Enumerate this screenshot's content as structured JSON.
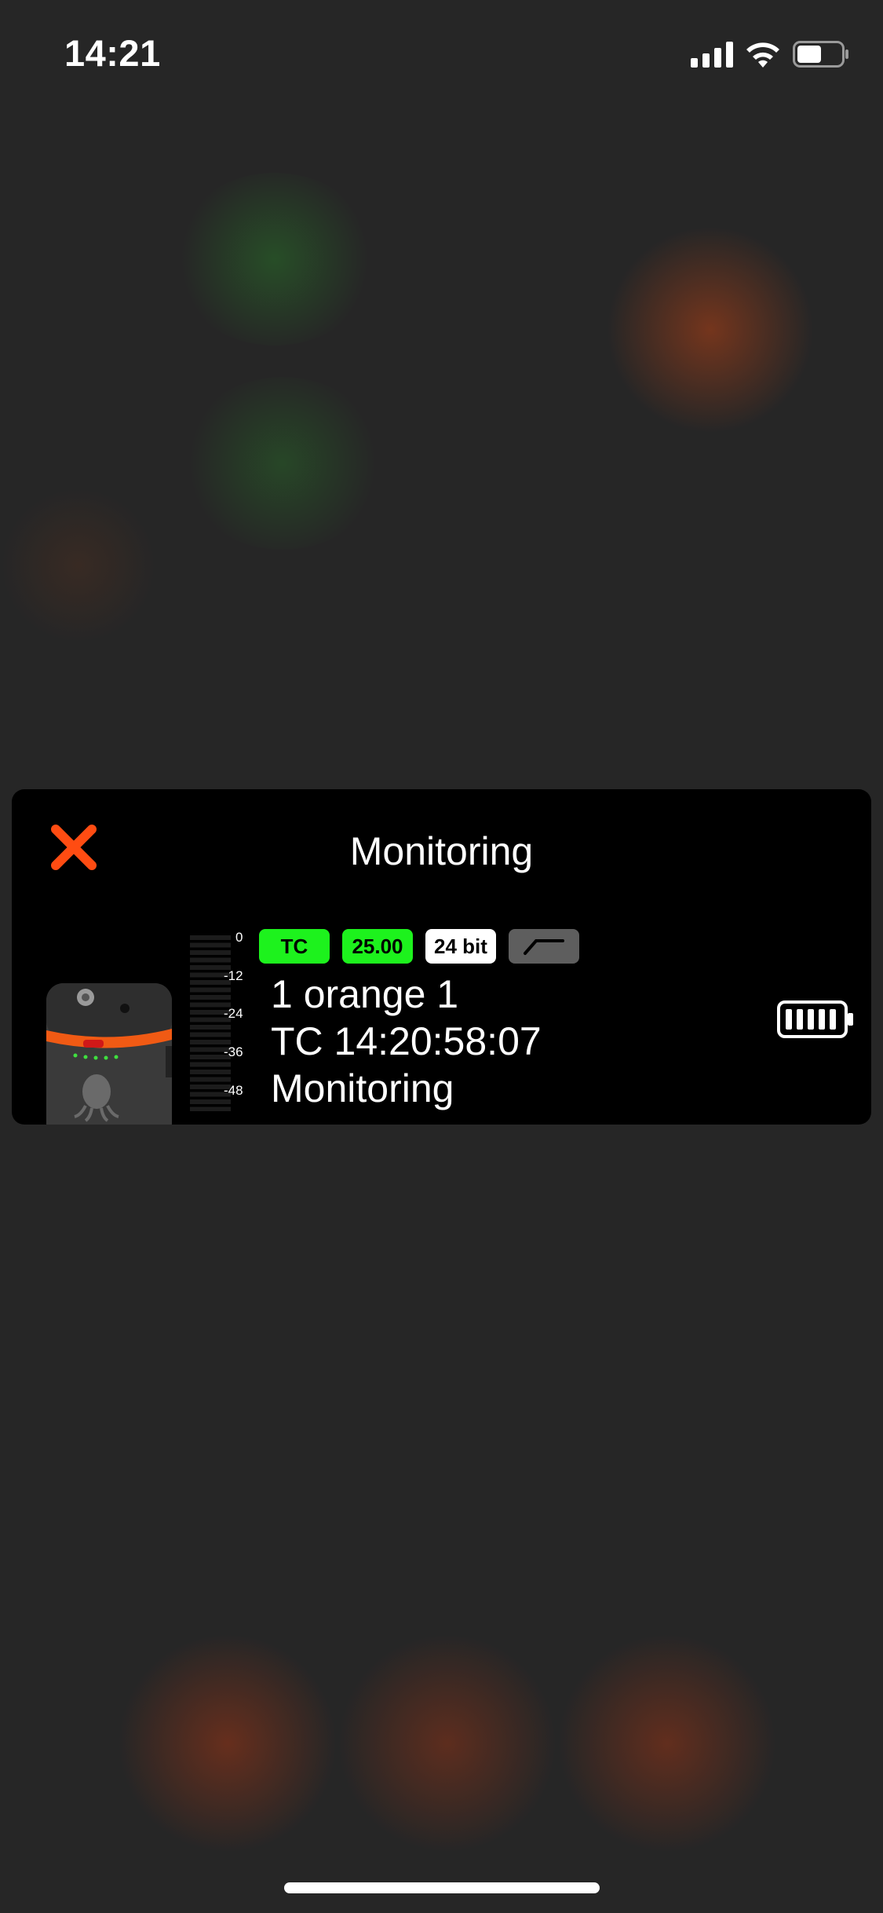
{
  "status_bar": {
    "time": "14:21",
    "icons": [
      "cellular-signal-icon",
      "wifi-icon",
      "battery-icon"
    ]
  },
  "monitoring_panel": {
    "title": "Monitoring",
    "close_icon": "close-x-icon",
    "device_image": "tentacle-track-recorder",
    "meter": {
      "scale_labels": [
        "0",
        "-12",
        "-24",
        "-36",
        "-48"
      ],
      "level_color": "#2fb34a"
    },
    "badges": {
      "timecode": "TC",
      "framerate": "25.00",
      "bit_depth": "24 bit",
      "filter_icon": "low-cut-filter-icon"
    },
    "device_name": "1 orange 1",
    "timecode": "TC 14:20:58:07",
    "state": "Monitoring",
    "battery_icon": "battery-full-icon"
  },
  "colors": {
    "accent_orange": "#ff4c12",
    "badge_green": "#1df21d",
    "panel_bg": "#000000",
    "page_bg": "#262626"
  }
}
